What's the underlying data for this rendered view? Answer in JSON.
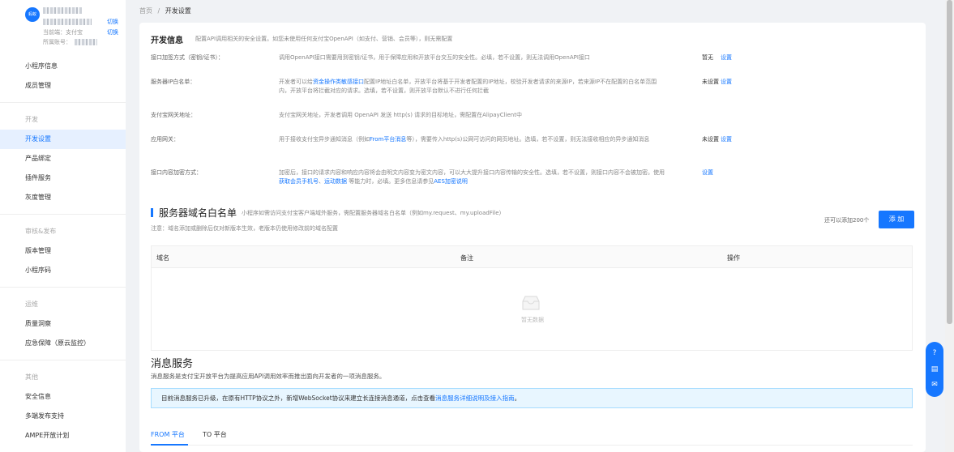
{
  "sidebar": {
    "avatar_text": "蚂蚁",
    "env_label": "当前端：支付宝",
    "account_label": "所属账号：",
    "switch1": "切换",
    "switch2": "切换",
    "items_top": [
      "小程序信息",
      "成员管理"
    ],
    "section_dev": "开发",
    "items_dev": [
      "开发设置",
      "产品绑定",
      "插件服务",
      "灰度管理"
    ],
    "section_release": "审核&发布",
    "items_release": [
      "版本管理",
      "小程序码"
    ],
    "section_ops": "运维",
    "items_ops": [
      "质量洞察",
      "应急保障（原云监控）"
    ],
    "section_other": "其他",
    "items_other": [
      "安全信息",
      "多端发布支持",
      "AMPE开放计划"
    ]
  },
  "breadcrumb": {
    "home": "首页",
    "sep": "/",
    "current": "开发设置"
  },
  "dev_info": {
    "title": "开发信息",
    "desc": "配置API调用相关的安全设置。如您未使用任何支付宝OpenAPI（如支付、营销、会员等），则无需配置",
    "rows": [
      {
        "key": "接口加签方式（密钥/证书）：",
        "value": "调用OpenAPI接口需要用到密钥/证书，用于保障应用和开放平台交互的安全性。必填，若不设置，则无法调用OpenAPI接口",
        "status": "暂无",
        "action": "设置"
      },
      {
        "key": "服务器IP白名单：",
        "value_pre": "开发者可以给",
        "value_link": "资金操作类敏感接口",
        "value_post": "配置IP地址白名单，开放平台将基于开发者配置的IP地址，校验开发者请求的来源IP，若来源IP不在配置的白名单范围内，开放平台将拦截对应的请求。选填，若不设置，则开放平台默认不进行任何拦截",
        "status": "未设置",
        "action": "设置"
      },
      {
        "key": "支付宝网关地址：",
        "value": "支付宝网关地址，开发者调用 OpenAPI 发送 http(s) 请求的目标地址，需配置在AlipayClient中",
        "status": "",
        "action": ""
      },
      {
        "key": "应用网关：",
        "value_pre": "用于接收支付宝异步通知消息（例如",
        "value_link": "From平台消息",
        "value_post": "等），需要传入http(s)公网可访问的网页地址。选填，若不设置，则无法接收相应的异步通知消息",
        "status": "未设置",
        "action": "设置"
      },
      {
        "key": "接口内容加密方式：",
        "value_pre": "加密后，接口的请求内容和响应内容将会由明文内容变为密文内容，可以大大提升接口内容传输的安全性。选填，若不设置，则接口内容不会被加密。使用 ",
        "value_link": "获取会员手机号",
        "value_mid": "、",
        "value_link2": "运动数据",
        "value_post2": " 等能力时，必填。更多信息请参见",
        "value_link3": "AES加密说明",
        "status": "",
        "action": "设置"
      }
    ]
  },
  "whitelist": {
    "title": "服务器域名白名单",
    "desc": "小程序如需访问支付宝客户端域外服务，需配置服务器域名白名单（例如my.request、my.uploadFile）",
    "note": "注意：域名添加或删除后仅对新版本生效，老版本仍使用修改前的域名配置",
    "remaining": "还可以添加200个",
    "add_label": "添 加",
    "columns": [
      "域名",
      "备注",
      "操作"
    ],
    "empty_text": "暂无数据"
  },
  "message": {
    "title": "消息服务",
    "desc": "消息服务是支付宝开放平台为提高应用API调用效率而推出面向开发者的一项消息服务。",
    "notice_pre": "目前消息服务已升级，在原有HTTP协议之外，新增WebSocket协议来建立长连接消息通道，点击查看",
    "notice_link": "消息服务详细说明及接入指南",
    "notice_post": "。",
    "tabs": [
      "FROM 平台",
      "TO 平台"
    ]
  },
  "colors": {
    "primary": "#1677ff",
    "bg": "#f0f2f5"
  }
}
